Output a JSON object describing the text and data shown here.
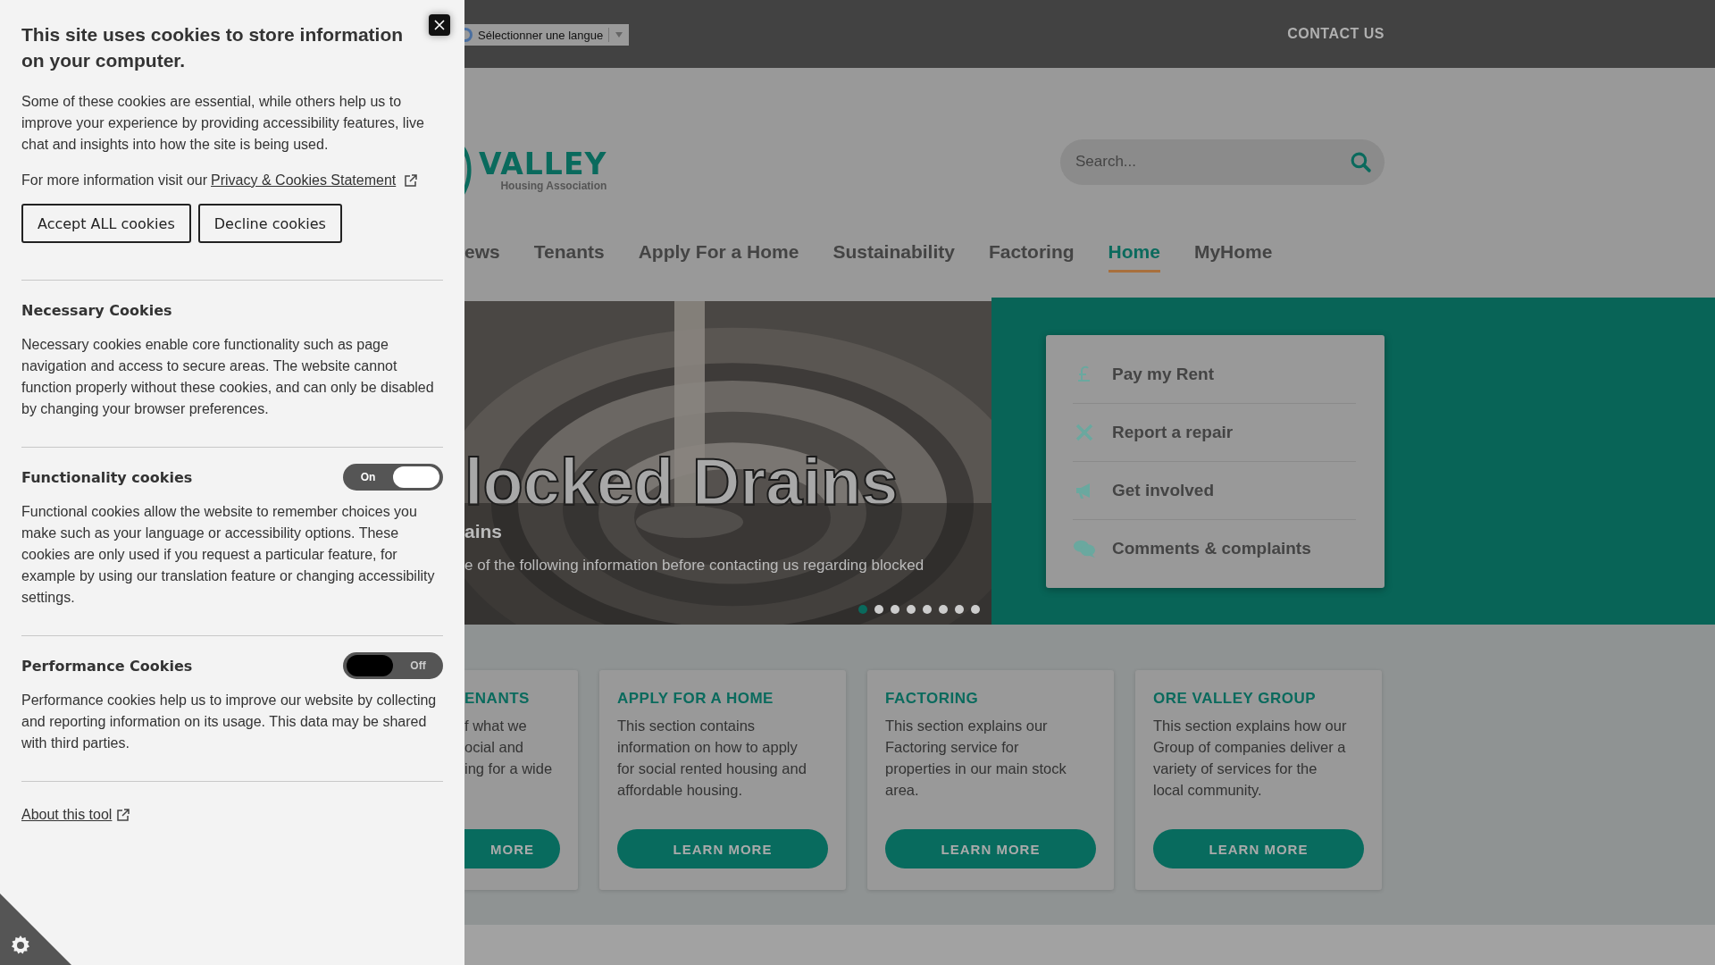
{
  "cookie_panel": {
    "title": "This site uses cookies to store information on your computer.",
    "intro": "Some of these cookies are essential, while others help us to improve your experience by providing accessibility features, live chat and insights into how the site is being used.",
    "more_info": {
      "text": "For more information visit our",
      "link": "Privacy & Cookies Statement"
    },
    "buttons": [
      "Accept ALL cookies",
      "Decline cookies"
    ],
    "sections": [
      {
        "title": "Necessary Cookies",
        "kind": "plain",
        "description": "Necessary cookies enable core functionality such as page navigation and access to secure areas. The website cannot function properly without these cookies, and can only be disabled by changing your browser preferences."
      },
      {
        "title": "Functionality cookies",
        "kind": "toggle",
        "toggle_label": "On",
        "on": true,
        "description": "Functional cookies allow the website to remember choices you make such as your language or accessibility options. These cookies are only used if you request a particular feature, for example by using our translation feature or changing accessibility settings."
      },
      {
        "title": "Performance Cookies",
        "kind": "toggle",
        "toggle_label": "Off",
        "on": false,
        "description": "Performance cookies help us to improve our website by collecting and reporting information on its usage. This data may be shared with third parties."
      }
    ],
    "about_link": "About this tool"
  },
  "top_bar": {
    "language_select": "Sélectionner une langue",
    "contact": "CONTACT US"
  },
  "logo": {
    "name": "VALLEY",
    "tagline": "Housing Association"
  },
  "search": {
    "placeholder": "Search..."
  },
  "nav": [
    {
      "label": "ews",
      "selected": false
    },
    {
      "label": "Tenants",
      "selected": false
    },
    {
      "label": "Apply For a Home",
      "selected": false
    },
    {
      "label": "Sustainability",
      "selected": false
    },
    {
      "label": "Factoring",
      "selected": false
    },
    {
      "label": "Home",
      "selected": true
    },
    {
      "label": "MyHome",
      "selected": false
    }
  ],
  "hero": {
    "title": "locked Drains",
    "subtitle": "ains",
    "text": "e of the following information before contacting us regarding blocked",
    "dots": [
      {
        "selected": true
      },
      {
        "selected": false
      },
      {
        "selected": false
      },
      {
        "selected": false
      },
      {
        "selected": false
      },
      {
        "selected": false
      },
      {
        "selected": false
      },
      {
        "selected": false
      }
    ]
  },
  "quick_links": [
    "Pay my Rent",
    "Report a repair",
    "Get involved",
    "Comments & complaints"
  ],
  "cards": [
    {
      "title": "ENANTS",
      "lines": [
        "f what we",
        "ocial and",
        "ing for a wide"
      ],
      "button": "MORE"
    },
    {
      "title": "APPLY FOR A HOME",
      "lines": [
        "This section contains",
        "information on how to apply",
        "for social rented housing and",
        "affordable housing."
      ],
      "button": "LEARN MORE"
    },
    {
      "title": "FACTORING",
      "lines": [
        "This section explains our",
        "Factoring service for",
        "properties in our main stock",
        "area."
      ],
      "button": "LEARN MORE"
    },
    {
      "title": "ORE VALLEY GROUP",
      "lines": [
        "This section explains how our",
        "Group of companies deliver a",
        "variety of services for the",
        "local community."
      ],
      "button": "LEARN MORE"
    }
  ]
}
